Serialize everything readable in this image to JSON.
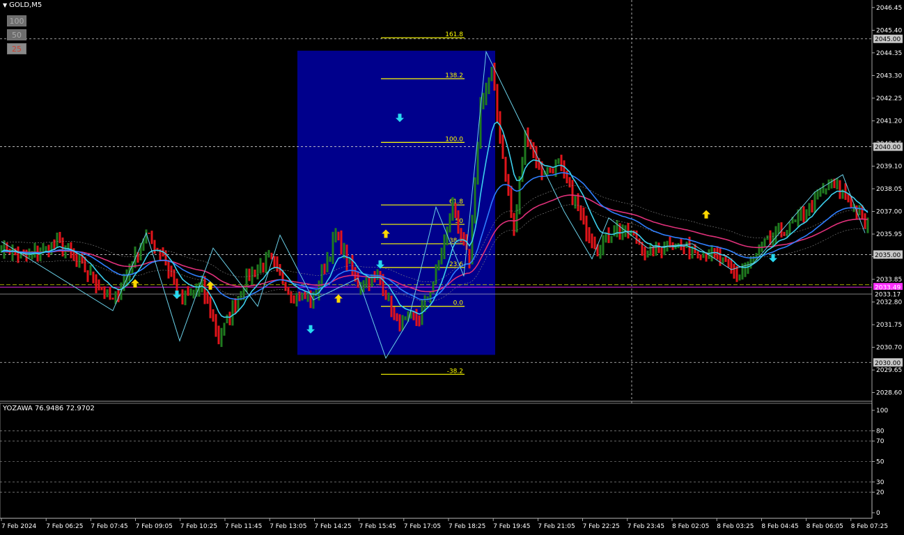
{
  "header": {
    "symbol": "GOLD,M5"
  },
  "period_buttons": [
    "100",
    "50",
    "25"
  ],
  "oscillator": {
    "label": "YOZAWA 76.9486 72.9702",
    "levels": [
      "100",
      "80",
      "70",
      "50",
      "30",
      "20",
      "0"
    ]
  },
  "price_labels": [
    "2046.45",
    "2045.40",
    "2044.35",
    "2043.30",
    "2042.25",
    "2041.20",
    "2040.15",
    "2039.10",
    "2038.05",
    "2037.00",
    "2035.95",
    "2034.90",
    "2033.85",
    "2032.80",
    "2031.75",
    "2030.70",
    "2029.65",
    "2028.60"
  ],
  "markers": {
    "level_2045": "2045.00",
    "level_2040": "2040.00",
    "level_2035": "2035.00",
    "level_2030": "2030.00",
    "pink_line": "2033.49",
    "current_price": "2033.17"
  },
  "time_labels": [
    "7 Feb 2024",
    "7 Feb 06:25",
    "7 Feb 07:45",
    "7 Feb 09:05",
    "7 Feb 10:25",
    "7 Feb 11:45",
    "7 Feb 13:05",
    "7 Feb 14:25",
    "7 Feb 15:45",
    "7 Feb 17:05",
    "7 Feb 18:25",
    "7 Feb 19:45",
    "7 Feb 21:05",
    "7 Feb 22:25",
    "7 Feb 23:45",
    "8 Feb 02:05",
    "8 Feb 03:25",
    "8 Feb 04:45",
    "8 Feb 06:05",
    "8 Feb 07:25"
  ],
  "fib_levels": [
    {
      "label": "161.8",
      "price": 2045.05
    },
    {
      "label": "138.2",
      "price": 2043.15
    },
    {
      "label": "100.0",
      "price": 2040.2
    },
    {
      "label": "61.8",
      "price": 2037.3
    },
    {
      "label": "50",
      "price": 2036.4
    },
    {
      "label": "38.2",
      "price": 2035.5
    },
    {
      "label": "23.6",
      "price": 2034.4
    },
    {
      "label": "0.0",
      "price": 2032.6
    },
    {
      "label": "-38.2",
      "price": 2029.45
    }
  ],
  "colors": {
    "bull": "#1f7a1f",
    "bear": "#e0141a",
    "fib_box": "#00008c",
    "fib_line": "#ffff00",
    "ma_fast": "#3cd0ee",
    "ma_mid": "#2f7fff",
    "ma_slow": "#e0307a",
    "arrow_up": "#ffd700",
    "arrow_down": "#28d8f0"
  },
  "chart_data": {
    "type": "line",
    "x": [
      0,
      1,
      2,
      3,
      4,
      5,
      6,
      7,
      8,
      9,
      10,
      11,
      12,
      13,
      14,
      15,
      16,
      17,
      18,
      19,
      20,
      21,
      22,
      23,
      24,
      25,
      26,
      27,
      28,
      29,
      30,
      31,
      32,
      33,
      34,
      35,
      36,
      37,
      38,
      39,
      40,
      41,
      42,
      43,
      44,
      45,
      46,
      47,
      48,
      49,
      50,
      51,
      52,
      53,
      54,
      55,
      56,
      57,
      58,
      59,
      60,
      61,
      62,
      63,
      64,
      65,
      66,
      67,
      68,
      69,
      70,
      71,
      72,
      73,
      74,
      75,
      76,
      77,
      78,
      79,
      80,
      81,
      82,
      83,
      84,
      85,
      86,
      87,
      88,
      89,
      90,
      91,
      92,
      93,
      94,
      95,
      96,
      97,
      98,
      99,
      100,
      101,
      102,
      103,
      104,
      105,
      106,
      107,
      108,
      109,
      110,
      111,
      112,
      113,
      114,
      115,
      116,
      117,
      118,
      119,
      120,
      121,
      122,
      123,
      124,
      125,
      126,
      127,
      128,
      129,
      130,
      131,
      132,
      133,
      134,
      135,
      136,
      137,
      138,
      139,
      140,
      141,
      142,
      143,
      144,
      145,
      146,
      147,
      148,
      149,
      150,
      151,
      152,
      153,
      154,
      155,
      156,
      157,
      158,
      159,
      160,
      161,
      162,
      163,
      164,
      165,
      166,
      167,
      168,
      169,
      170,
      171,
      172,
      173,
      174,
      175,
      176,
      177,
      178,
      179,
      180,
      181,
      182,
      183,
      184,
      185,
      186,
      187,
      188,
      189,
      190,
      191,
      192,
      193,
      194,
      195,
      196,
      197,
      198,
      199,
      200,
      201,
      202,
      203,
      204,
      205,
      206,
      207,
      208,
      209,
      210,
      211,
      212,
      213,
      214,
      215,
      216,
      217,
      218,
      219,
      220,
      221,
      222,
      223,
      224,
      225,
      226,
      227,
      228,
      229,
      230,
      231,
      232,
      233,
      234,
      235,
      236,
      237,
      238,
      239,
      240,
      241,
      242,
      243,
      244,
      245,
      246,
      247,
      248,
      249,
      250,
      251,
      252,
      253,
      254,
      255,
      256,
      257,
      258,
      259,
      260,
      261,
      262,
      263,
      264,
      265,
      266,
      267,
      268,
      269,
      270,
      271,
      272,
      273,
      274,
      275,
      276,
      277,
      278,
      279,
      280,
      281,
      282,
      283,
      284,
      285,
      286,
      287,
      288,
      289,
      290,
      291,
      292,
      293,
      294,
      295,
      296,
      297,
      298,
      299,
      300,
      301,
      302,
      303,
      304,
      305,
      306,
      307,
      308,
      309,
      310,
      311
    ],
    "close_anchors": [
      [
        0,
        2035.4
      ],
      [
        8,
        2034.8
      ],
      [
        20,
        2035.5
      ],
      [
        30,
        2034.3
      ],
      [
        40,
        2032.8
      ],
      [
        52,
        2035.9
      ],
      [
        58,
        2035.0
      ],
      [
        64,
        2032.9
      ],
      [
        72,
        2033.5
      ],
      [
        78,
        2031.1
      ],
      [
        88,
        2033.9
      ],
      [
        96,
        2034.8
      ],
      [
        104,
        2033.2
      ],
      [
        112,
        2032.9
      ],
      [
        120,
        2035.9
      ],
      [
        128,
        2033.6
      ],
      [
        136,
        2033.9
      ],
      [
        142,
        2031.8
      ],
      [
        150,
        2032.1
      ],
      [
        156,
        2034.1
      ],
      [
        162,
        2037.2
      ],
      [
        168,
        2034.5
      ],
      [
        172,
        2042.0
      ],
      [
        176,
        2043.5
      ],
      [
        180,
        2039.5
      ],
      [
        184,
        2036.0
      ],
      [
        188,
        2040.6
      ],
      [
        194,
        2038.8
      ],
      [
        200,
        2039.2
      ],
      [
        206,
        2037.4
      ],
      [
        210,
        2036.2
      ],
      [
        214,
        2035.3
      ],
      [
        220,
        2036.2
      ],
      [
        226,
        2036.0
      ],
      [
        232,
        2035.0
      ],
      [
        240,
        2035.6
      ],
      [
        248,
        2035.2
      ],
      [
        256,
        2035.0
      ],
      [
        264,
        2034.0
      ],
      [
        268,
        2034.5
      ],
      [
        274,
        2035.5
      ],
      [
        280,
        2036.0
      ],
      [
        286,
        2036.6
      ],
      [
        292,
        2037.5
      ],
      [
        298,
        2038.3
      ],
      [
        302,
        2037.9
      ],
      [
        306,
        2037.2
      ],
      [
        310,
        2036.3
      ]
    ],
    "series": [],
    "ylim": [
      2028.2,
      2046.8
    ],
    "osc_ylim": [
      0,
      100
    ]
  }
}
